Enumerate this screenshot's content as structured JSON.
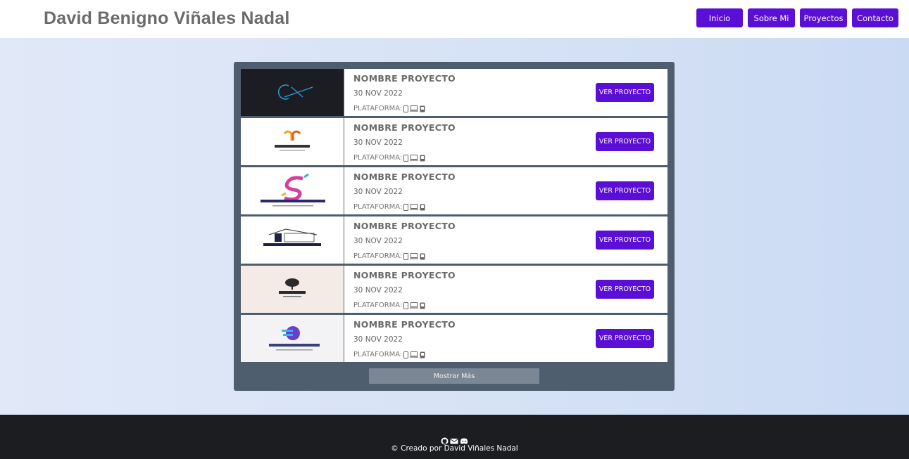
{
  "header": {
    "title": "David Benigno Viñales Nadal",
    "nav": [
      {
        "label": "Inicio",
        "name": "nav-inicio-button"
      },
      {
        "label": "Sobre Mi",
        "name": "nav-sobre-mi-button"
      },
      {
        "label": "Proyectos",
        "name": "nav-proyectos-button"
      },
      {
        "label": "Contacto",
        "name": "nav-contacto-button"
      }
    ]
  },
  "projects": {
    "items": [
      {
        "name": "NOMBRE PROYECTO",
        "date": "30 NOV 2022",
        "platform_label": "PLATAFORMA:",
        "button": "VER PROYECTO",
        "logo": "cx-logo"
      },
      {
        "name": "NOMBRE PROYECTO",
        "date": "30 NOV 2022",
        "platform_label": "PLATAFORMA:",
        "button": "VER PROYECTO",
        "logo": "lorem-ipsum-orange-logo",
        "logo_text": "Lorem Ipsum"
      },
      {
        "name": "NOMBRE PROYECTO",
        "date": "30 NOV 2022",
        "platform_label": "PLATAFORMA:",
        "button": "VER PROYECTO",
        "logo": "lorem-ipsum-s-logo",
        "logo_text": "LOREMIPSUM"
      },
      {
        "name": "NOMBRE PROYECTO",
        "date": "30 NOV 2022",
        "platform_label": "PLATAFORMA:",
        "button": "VER PROYECTO",
        "logo": "construction-logo",
        "logo_text": "CONSTRUCTION"
      },
      {
        "name": "NOMBRE PROYECTO",
        "date": "30 NOV 2022",
        "platform_label": "PLATAFORMA:",
        "button": "VER PROYECTO",
        "logo": "oaktrees-logo",
        "logo_text": "OAKTREES"
      },
      {
        "name": "NOMBRE PROYECTO",
        "date": "30 NOV 2022",
        "platform_label": "PLATAFORMA:",
        "button": "VER PROYECTO",
        "logo": "digital-logo",
        "logo_text": "DIGITAL"
      }
    ],
    "platform_icons": [
      "mobile-icon",
      "laptop-icon",
      "desktop-icon"
    ],
    "more_button": "Mostrar Más"
  },
  "footer": {
    "icons": [
      "github-icon",
      "email-icon",
      "discord-icon"
    ],
    "credit": "© Creado por David Viñales Nadal"
  },
  "colors": {
    "accent": "#5b0fd6",
    "panel": "#4e5e6f",
    "footer": "#1c1d21",
    "more_button": "#7b8794"
  }
}
